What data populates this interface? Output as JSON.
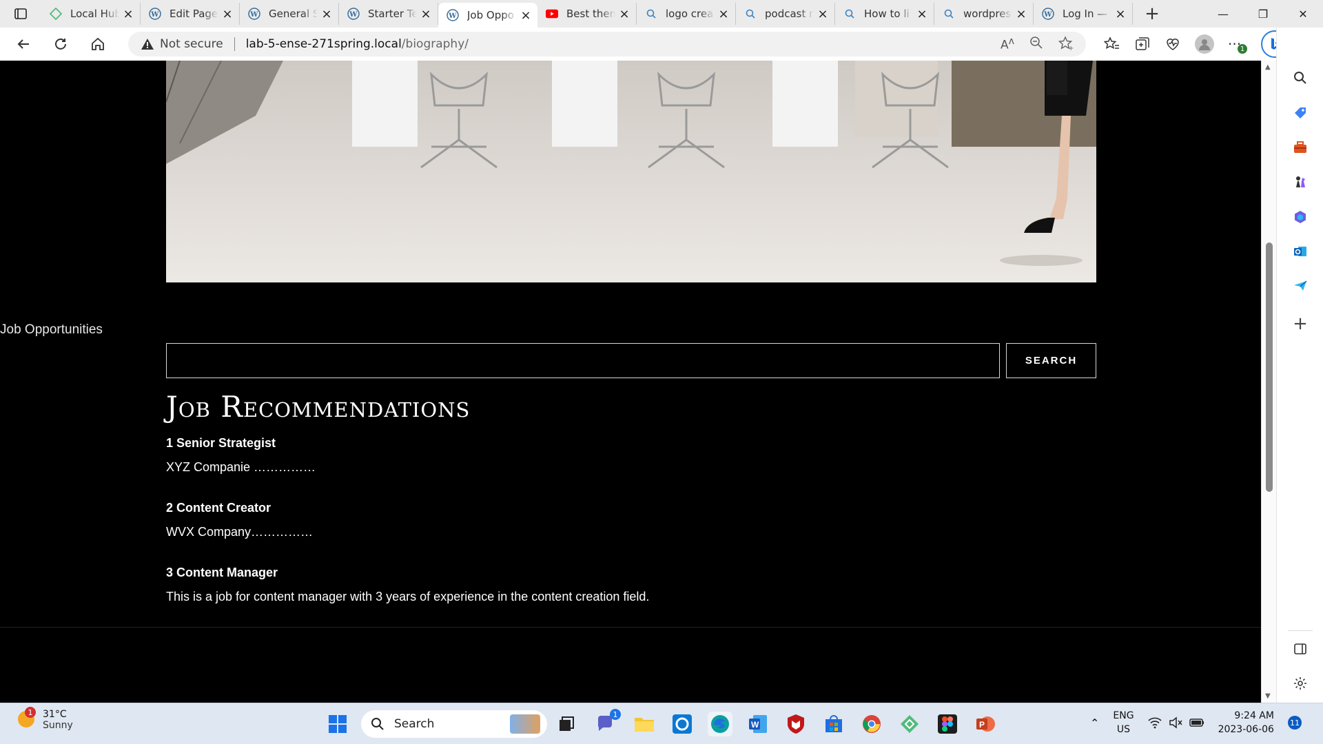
{
  "browser": {
    "tabs": [
      {
        "title": "Local Hub",
        "icon": "localwp-icon"
      },
      {
        "title": "Edit Page",
        "icon": "wordpress-icon"
      },
      {
        "title": "General S",
        "icon": "wordpress-icon"
      },
      {
        "title": "Starter Te",
        "icon": "wordpress-icon"
      },
      {
        "title": "Job Oppo",
        "icon": "wordpress-icon",
        "active": true
      },
      {
        "title": "Best them",
        "icon": "youtube-icon"
      },
      {
        "title": "logo crea",
        "icon": "search-icon"
      },
      {
        "title": "podcast n",
        "icon": "search-icon"
      },
      {
        "title": "How to li",
        "icon": "search-icon"
      },
      {
        "title": "wordpres",
        "icon": "search-icon"
      },
      {
        "title": "Log In —",
        "icon": "wordpress-icon"
      }
    ],
    "address": {
      "security": "Not secure",
      "host": "lab-5-ense-271spring.local",
      "path": "/biography/"
    },
    "extensions_badge": "1"
  },
  "page": {
    "side_title": "Job Opportunities",
    "search_button": "SEARCH",
    "search_placeholder": "",
    "heading": "Job Recommendations",
    "jobs": [
      {
        "title": "1 Senior Strategist",
        "desc": "XYZ Companie ……………"
      },
      {
        "title": "2 Content Creator",
        "desc": "WVX Company……………"
      },
      {
        "title": "3 Content Manager",
        "desc": "This is a job for content manager with 3 years of experience in the content creation field."
      }
    ]
  },
  "taskbar": {
    "weather_badge": "1",
    "temperature": "31°C",
    "condition": "Sunny",
    "search_label": "Search",
    "teams_badge": "1",
    "language": "ENG",
    "region": "US",
    "time": "9:24 AM",
    "date": "2023-06-06",
    "notifications": "11"
  },
  "colors": {
    "page_bg": "#000000",
    "accent_edge": "#0078d4",
    "youtube_red": "#ff0000"
  }
}
